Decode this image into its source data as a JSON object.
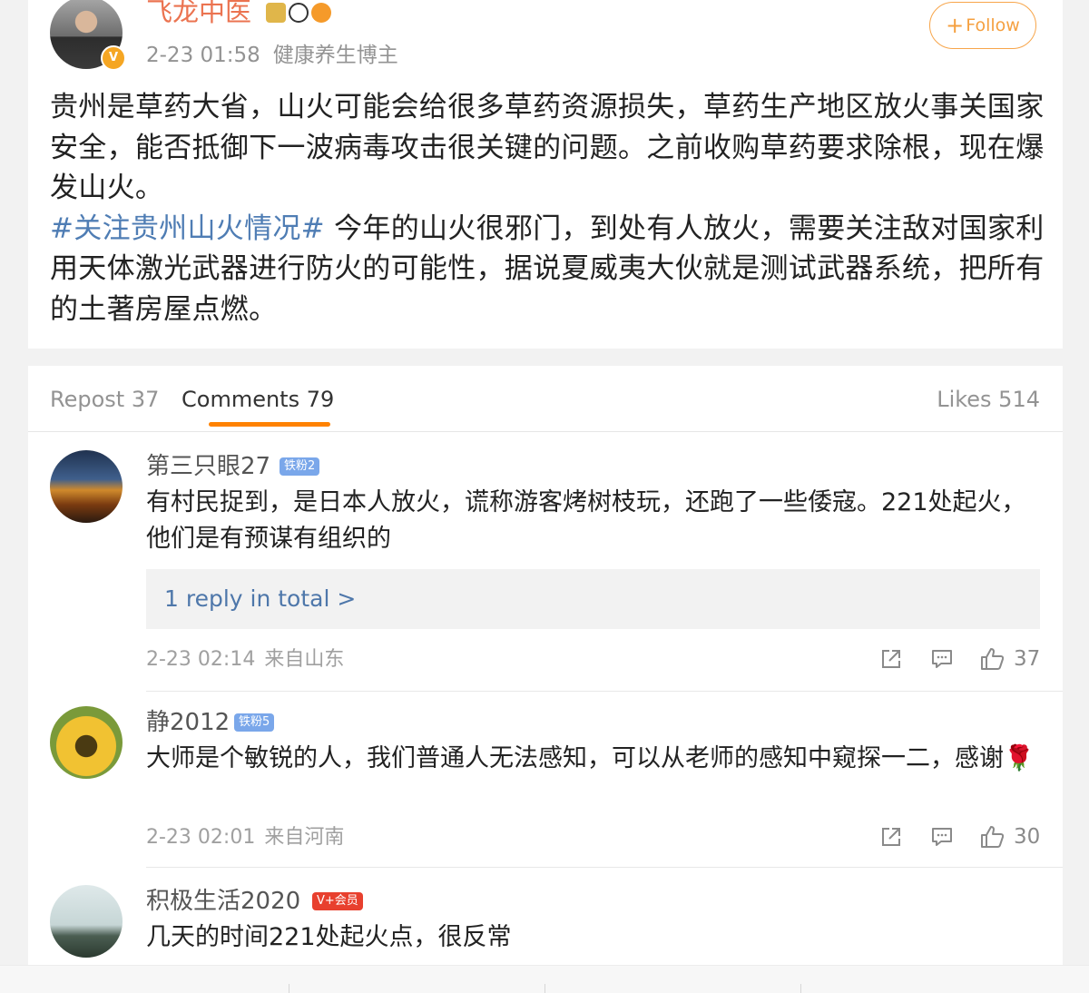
{
  "post": {
    "author": "飞龙中医",
    "time": "2-23 01:58",
    "author_title": "健康养生博主",
    "follow_label": "Follow",
    "body": {
      "line1": "贵州是草药大省，山火可能会给很多草药资源损失，草药生产地区放火事关国家安全，能否抵御下一波病毒攻击很关键的问题。之前收购草药要求除根，现在爆发山火。",
      "hashtag": "#关注贵州山火情况#",
      "line2": " 今年的山火很邪门，到处有人放火，需要关注敌对国家利用天体激光武器进行防火的可能性，据说夏威夷大伙就是测试武器系统，把所有的土著房屋点燃。"
    }
  },
  "tabs": {
    "repost": "Repost 37",
    "comments": "Comments 79",
    "likes": "Likes 514"
  },
  "comments": [
    {
      "name": "第三只眼27",
      "badge": "铁粉2",
      "text": "有村民捉到，是日本人放火，谎称游客烤树枝玩，还跑了一些倭寇。221处起火，他们是有预谋有组织的",
      "reply_link": "1 reply in total >",
      "time": "2-23 02:14",
      "location": "来自山东",
      "likes": "37"
    },
    {
      "name": "静2012",
      "badge": "铁粉5",
      "text": "大师是个敏锐的人，我们普通人无法感知，可以从老师的感知中窥探一二，感谢",
      "emoji": "🌹",
      "time": "2-23 02:01",
      "location": "来自河南",
      "likes": "30"
    },
    {
      "name": "积极生活2020",
      "badge": "V+会员",
      "text": "几天的时间221处起火点，很反常"
    }
  ],
  "icons": {
    "share": "share-icon",
    "comment": "comment-icon",
    "like": "thumbs-up-icon",
    "verified": "verified-badge-icon"
  },
  "colors": {
    "author_orange": "#eb7350",
    "hashtag_blue": "#4f7db4",
    "follow_orange": "#f5a040",
    "tab_underline": "#ff8200",
    "reply_link_blue": "#4e77aa"
  }
}
